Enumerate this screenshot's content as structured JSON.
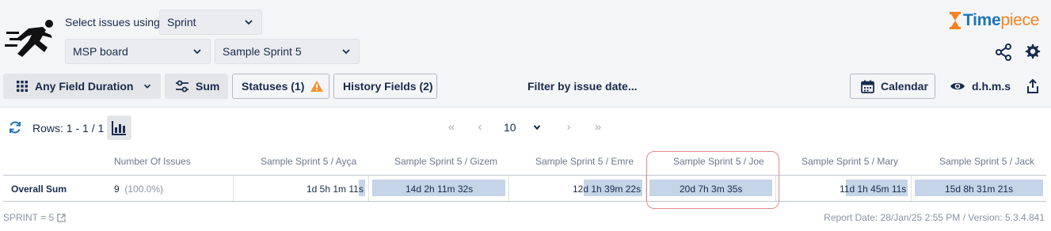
{
  "toolbar": {
    "select_label": "Select issues using",
    "select_mode": "Sprint",
    "board": "MSP board",
    "sprint": "Sample Sprint 5",
    "any_field_duration": "Any Field Duration",
    "sum": "Sum",
    "statuses": "Statuses (1)",
    "history_fields": "History Fields (2)",
    "filter": "Filter by issue date...",
    "calendar": "Calendar",
    "time_format": "d.h.m.s"
  },
  "brand": {
    "logo_part1": "Time",
    "logo_part2": "piece",
    "accent_orange": "#f58220",
    "accent_blue": "#1f76b6"
  },
  "pagination": {
    "rows": "Rows: 1 - 1 / 1",
    "page_size": "10"
  },
  "table": {
    "headers": [
      "Number Of Issues",
      "Sample Sprint 5 / Ayça",
      "Sample Sprint 5 / Gizem",
      "Sample Sprint 5 / Emre",
      "Sample Sprint 5 / Joe",
      "Sample Sprint 5 / Mary",
      "Sample Sprint 5 / Jack"
    ],
    "row": {
      "label": "Overall Sum",
      "count": "9",
      "percent": "(100.0%)",
      "values": [
        "1d 5h 1m 11s",
        "14d 2h 11m 32s",
        "12d 1h 39m 22s",
        "20d 7h 3m 35s",
        "11d 1h 45m 11s",
        "15d 8h 31m 21s"
      ],
      "bar_fraction": [
        0.05,
        1.0,
        0.45,
        1.0,
        0.48,
        1.0
      ]
    }
  },
  "footer": {
    "filter": "SPRINT = 5",
    "report": "Report Date: 28/Jan/25 2:55 PM / Version: 5.3.4.841"
  },
  "colors": {
    "bar": "#c5d4e6",
    "highlight": "#e28a8a",
    "warning": "#f79232"
  }
}
